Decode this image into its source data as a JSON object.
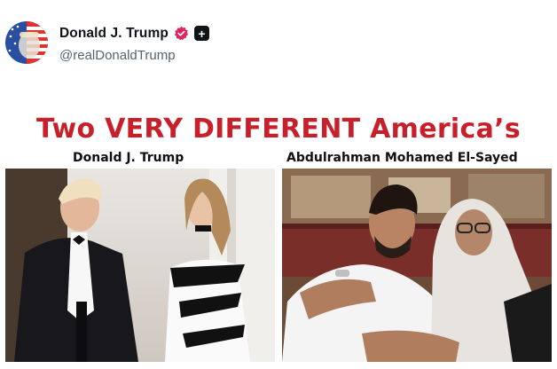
{
  "post": {
    "author": {
      "display_name": "Donald J. Trump",
      "handle": "@realDonaldTrump",
      "avatar_icon": "avatar-flag-portrait",
      "verified_icon": "verified-badge-icon",
      "affiliate_icon": "plus-badge-icon",
      "plus_symbol": "+"
    },
    "meme": {
      "headline": "Two VERY DIFFERENT America’s",
      "headline_color": "#c8202a",
      "left_caption": "Donald J. Trump",
      "right_caption": "Abdulrahman Mohamed El-Sayed"
    }
  }
}
